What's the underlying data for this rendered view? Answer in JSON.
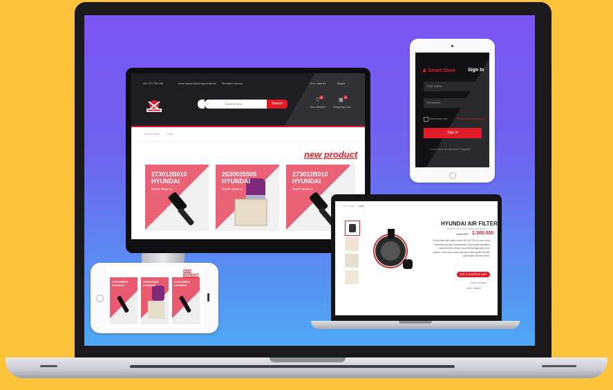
{
  "monitor": {
    "topbar": {
      "phone": "+84 379 758 989",
      "email": "www.nguyenthanhngocmail.net",
      "hours": "Timetable service",
      "account": "Your Cabinet",
      "lang": "Regist"
    },
    "search": {
      "placeholder": "Search here",
      "button": "Search"
    },
    "wishlist": {
      "label": "Your Wishlist",
      "count": "0"
    },
    "cart": {
      "label": "Shopping Cart",
      "count": "0"
    },
    "breadcrumb": {
      "home": "Home page",
      "current": "Login"
    },
    "section_title": "new product",
    "products": [
      {
        "code": "273012B010",
        "brand": "HYUNDAI",
        "cta": "SHOP NOW ⊙"
      },
      {
        "code": "2630035505",
        "brand": "HYUNDAI",
        "cta": "SHOP NOW ⊙"
      },
      {
        "code": "273012B010",
        "brand": "HYUNDAI",
        "cta": "SHOP NOW ⊙"
      }
    ]
  },
  "tablet": {
    "brand": "Smart Store",
    "title": "Sign In",
    "user_placeholder": "User name",
    "pass_placeholder": "Password",
    "remember": "Remember me",
    "forgot": "Forgot your password?",
    "button": "Sign In",
    "register": "Don't have an account? Register"
  },
  "macbook": {
    "breadcrumb": {
      "home": "Home page",
      "current": "Login"
    },
    "product_title": "HYUNDAI AIR FILTER",
    "meta": "Review: sold stock online ★★★★★",
    "old_price": "3.500.000",
    "price": "2.300.000",
    "description": "The air filter with outlet on the 3D/YG1 F100 is one of the essential and vital components in the overall ventilation system of the vehicle. Avoid air damage part of the system. It ensures a clean air flow to take gentle for both passengers and the driver.",
    "add_button": "ADD TO SHOPPING CART",
    "compare": "Add to compare",
    "wishlist": "Add to Wishlist"
  },
  "phone": {
    "section_title": "new product",
    "products": [
      {
        "code": "273012B010",
        "brand": "HYUNDAI"
      },
      {
        "code": "2630035505",
        "brand": "HYUNDAI"
      },
      {
        "code": "273012B010",
        "brand": "HYUNDAI"
      }
    ]
  },
  "colors": {
    "accent": "#e11d2a",
    "pink": "#e84e67",
    "background": "#fcc33b"
  }
}
